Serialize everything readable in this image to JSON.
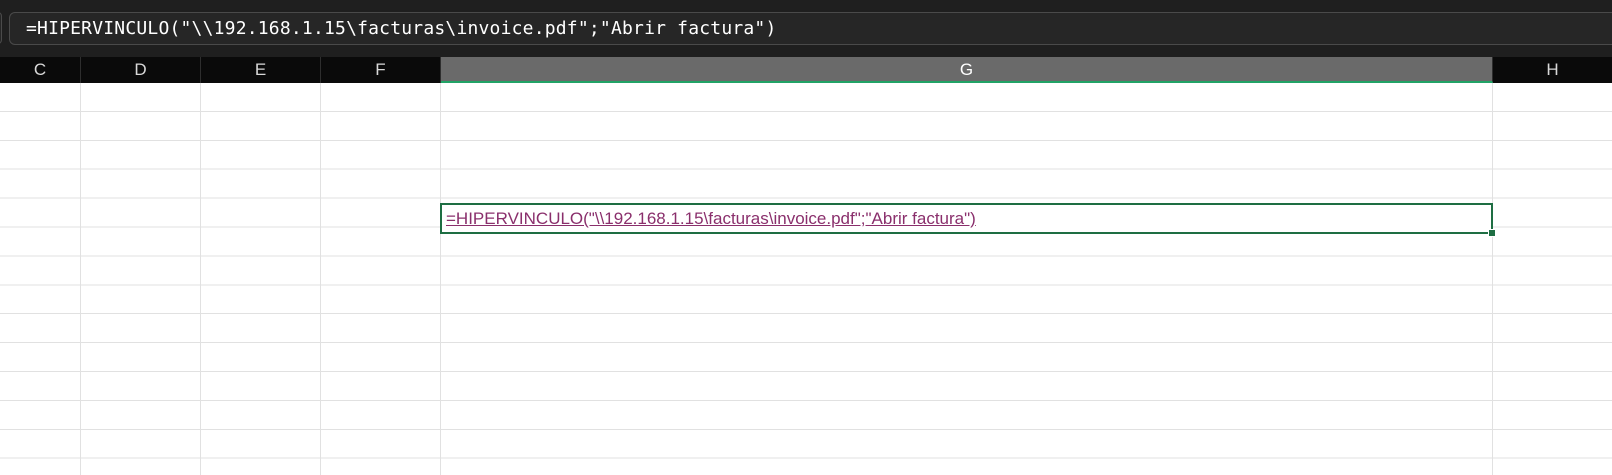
{
  "formula_bar": {
    "formula": "=HIPERVINCULO(\"\\\\192.168.1.15\\facturas\\invoice.pdf\";\"Abrir factura\")"
  },
  "columns": [
    {
      "letter": "C"
    },
    {
      "letter": "D"
    },
    {
      "letter": "E"
    },
    {
      "letter": "F"
    },
    {
      "letter": "G",
      "selected": true
    },
    {
      "letter": "H"
    }
  ],
  "active_cell": {
    "column": "G",
    "display_text": "=HIPERVINCULO(\"\\\\192.168.1.15\\facturas\\invoice.pdf\";\"Abrir factura\")",
    "is_hyperlink": true
  },
  "colors": {
    "header_bg": "#0a0a0a",
    "selected_header_bg": "#6a6a6a",
    "selection_border": "#1e6e43",
    "hyperlink": "#8a2f6c",
    "formula_bg": "#262626"
  }
}
